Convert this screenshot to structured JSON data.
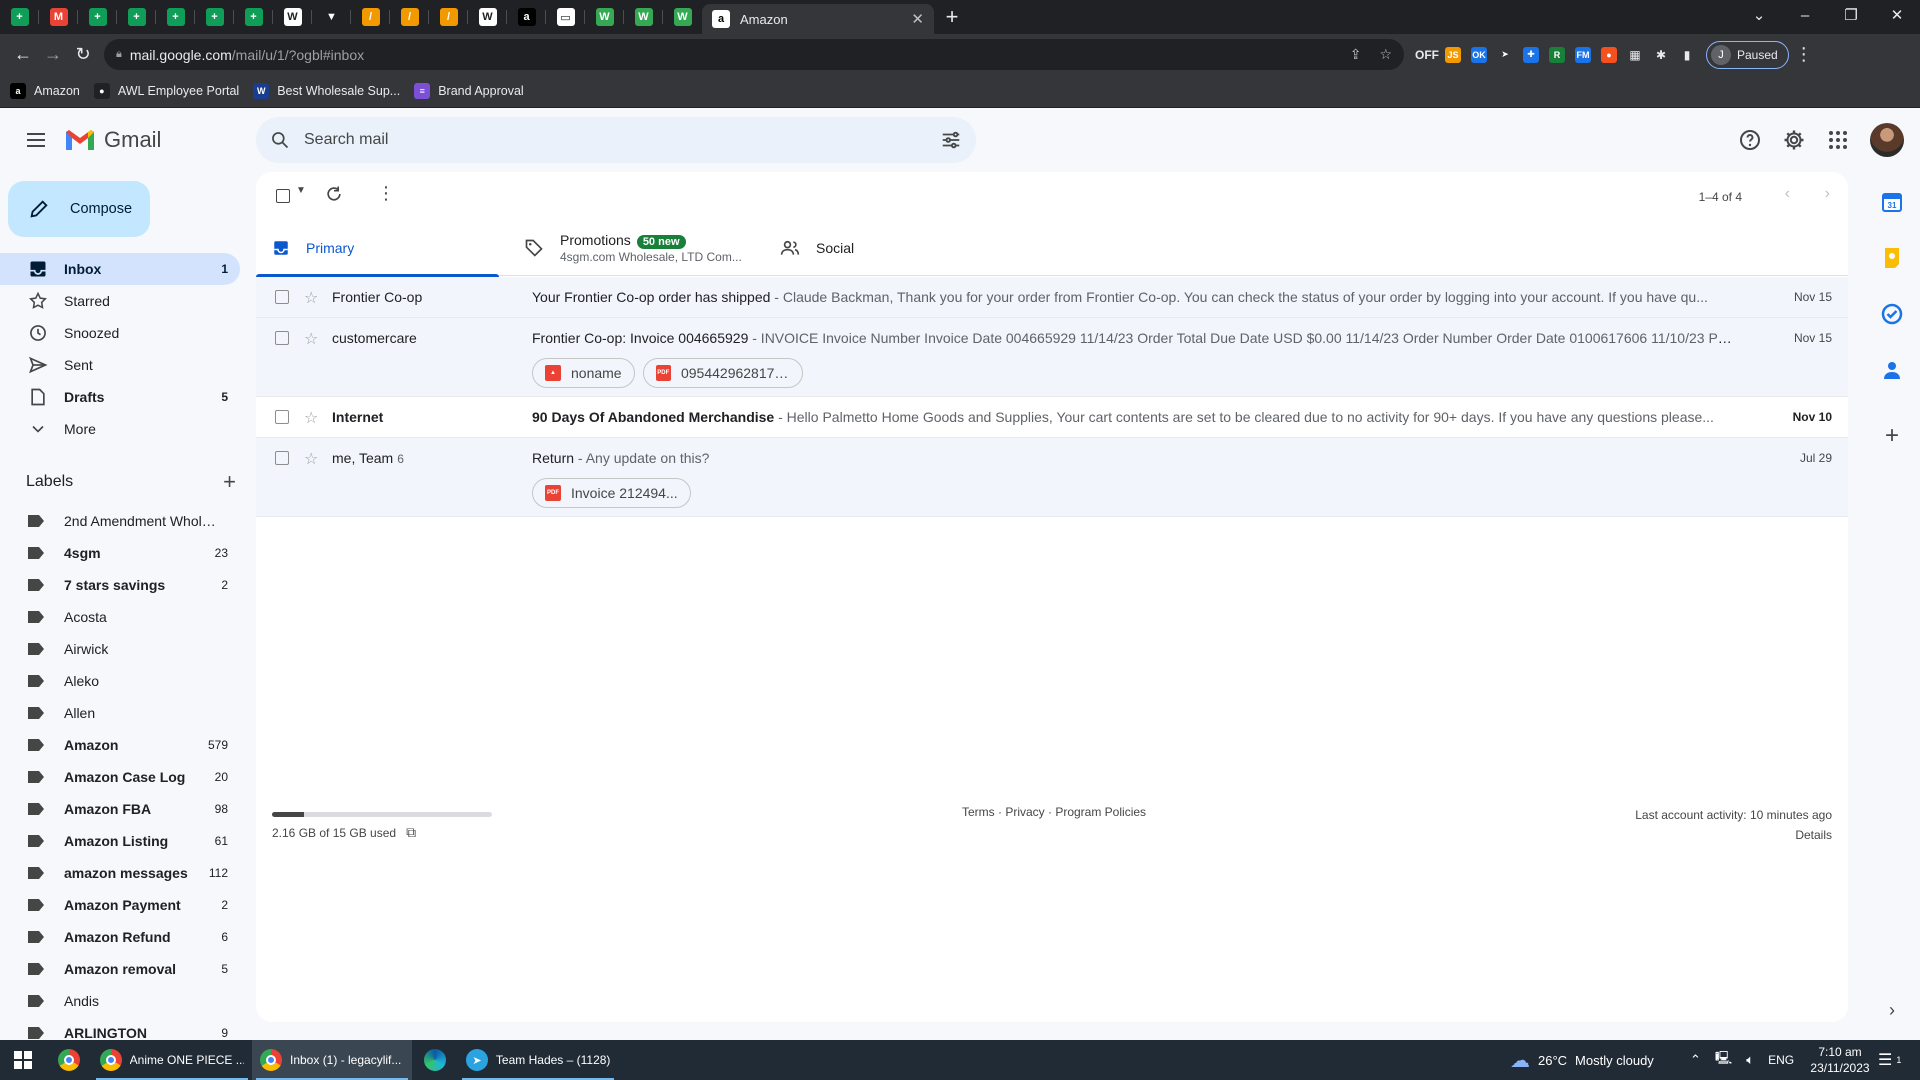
{
  "browser": {
    "active_tab_title": "Amazon",
    "pinned_tabs": [
      {
        "icon": "green-sheets-icon",
        "color": "#0f9d58",
        "glyph": "+"
      },
      {
        "icon": "gmail-icon",
        "color": "#ea4335",
        "glyph": "M"
      },
      {
        "icon": "green-sheets-icon",
        "color": "#0f9d58",
        "glyph": "+"
      },
      {
        "icon": "green-sheets-icon",
        "color": "#0f9d58",
        "glyph": "+"
      },
      {
        "icon": "green-sheets-icon",
        "color": "#0f9d58",
        "glyph": "+"
      },
      {
        "icon": "green-sheets-icon",
        "color": "#0f9d58",
        "glyph": "+"
      },
      {
        "icon": "green-sheets-icon",
        "color": "#0f9d58",
        "glyph": "+"
      },
      {
        "icon": "document-icon",
        "color": "#ffffff",
        "glyph": "W"
      },
      {
        "icon": "red-arrow-icon",
        "color": "#202124",
        "glyph": "▼"
      },
      {
        "icon": "slash-icon",
        "color": "#f29900",
        "glyph": "/"
      },
      {
        "icon": "slash-icon",
        "color": "#f29900",
        "glyph": "/"
      },
      {
        "icon": "slash-icon",
        "color": "#f29900",
        "glyph": "/"
      },
      {
        "icon": "document-icon",
        "color": "#ffffff",
        "glyph": "W"
      },
      {
        "icon": "amazon-icon",
        "color": "#000000",
        "glyph": "a"
      },
      {
        "icon": "image-icon",
        "color": "#ffffff",
        "glyph": "▭"
      },
      {
        "icon": "w-icon",
        "color": "#34a853",
        "glyph": "W"
      },
      {
        "icon": "w-icon",
        "color": "#34a853",
        "glyph": "W"
      },
      {
        "icon": "w-icon",
        "color": "#34a853",
        "glyph": "W"
      }
    ],
    "url_host": "mail.google.com",
    "url_path": "/mail/u/1/?ogbl#inbox",
    "profile_initial": "J",
    "profile_status": "Paused",
    "bookmarks": [
      {
        "label": "Amazon",
        "icon": "amazon-icon",
        "color": "#000000",
        "glyph": "a"
      },
      {
        "label": "AWL Employee Portal",
        "icon": "portal-icon",
        "color": "#202124",
        "glyph": "●"
      },
      {
        "label": "Best Wholesale Sup...",
        "icon": "wholesale-icon",
        "color": "#1a3e8f",
        "glyph": "W"
      },
      {
        "label": "Brand Approval",
        "icon": "brand-icon",
        "color": "#7b4fd6",
        "glyph": "≡"
      }
    ],
    "extensions": [
      {
        "icon": "off-extension-icon",
        "color": "#e8eaed",
        "glyph": "OFF"
      },
      {
        "icon": "js-extension-icon",
        "color": "#f29900",
        "glyph": "JS"
      },
      {
        "icon": "ok-extension-icon",
        "color": "#1a73e8",
        "glyph": "OK"
      },
      {
        "icon": "arrow-extension-icon",
        "color": "#35363a",
        "glyph": "➤"
      },
      {
        "icon": "puzzle-blue-icon",
        "color": "#1a73e8",
        "glyph": "✚"
      },
      {
        "icon": "r-extension-icon",
        "color": "#188038",
        "glyph": "R"
      },
      {
        "icon": "fm-extension-icon",
        "color": "#1a73e8",
        "glyph": "FM"
      },
      {
        "icon": "circle-extension-icon",
        "color": "#f4511e",
        "glyph": "●"
      },
      {
        "icon": "grid-extension-icon",
        "color": "#e8eaed",
        "glyph": "▦"
      },
      {
        "icon": "extensions-puzzle-icon",
        "color": "#e8eaed",
        "glyph": "✱"
      },
      {
        "icon": "side-panel-icon",
        "color": "#e8eaed",
        "glyph": "▮"
      }
    ]
  },
  "gmail": {
    "logo_text": "Gmail",
    "search_placeholder": "Search mail",
    "compose_label": "Compose",
    "nav": [
      {
        "name": "inbox",
        "label": "Inbox",
        "count": "1",
        "icon": "inbox-icon",
        "active": true
      },
      {
        "name": "starred",
        "label": "Starred",
        "count": "",
        "icon": "star-icon"
      },
      {
        "name": "snoozed",
        "label": "Snoozed",
        "count": "",
        "icon": "clock-icon"
      },
      {
        "name": "sent",
        "label": "Sent",
        "count": "",
        "icon": "send-icon"
      },
      {
        "name": "drafts",
        "label": "Drafts",
        "count": "5",
        "icon": "draft-icon",
        "bold": true
      },
      {
        "name": "more",
        "label": "More",
        "count": "",
        "icon": "chevron-down-icon"
      }
    ],
    "labels_title": "Labels",
    "labels": [
      {
        "label": "2nd Amendment Whole...",
        "count": "",
        "bold": false
      },
      {
        "label": "4sgm",
        "count": "23",
        "bold": true
      },
      {
        "label": "7 stars savings",
        "count": "2",
        "bold": true
      },
      {
        "label": "Acosta",
        "count": "",
        "bold": false
      },
      {
        "label": "Airwick",
        "count": "",
        "bold": false
      },
      {
        "label": "Aleko",
        "count": "",
        "bold": false
      },
      {
        "label": "Allen",
        "count": "",
        "bold": false
      },
      {
        "label": "Amazon",
        "count": "579",
        "bold": true
      },
      {
        "label": "Amazon Case Log",
        "count": "20",
        "bold": true
      },
      {
        "label": "Amazon FBA",
        "count": "98",
        "bold": true
      },
      {
        "label": "Amazon Listing",
        "count": "61",
        "bold": true
      },
      {
        "label": "amazon messages",
        "count": "112",
        "bold": true
      },
      {
        "label": "Amazon Payment",
        "count": "2",
        "bold": true
      },
      {
        "label": "Amazon Refund",
        "count": "6",
        "bold": true
      },
      {
        "label": "Amazon removal",
        "count": "5",
        "bold": true
      },
      {
        "label": "Andis",
        "count": "",
        "bold": false
      },
      {
        "label": "ARLINGTON",
        "count": "9",
        "bold": true
      }
    ],
    "pager": "1–4 of 4",
    "tabs": {
      "primary": "Primary",
      "promotions": "Promotions",
      "promotions_badge": "50 new",
      "promotions_sub": "4sgm.com Wholesale, LTD Com...",
      "social": "Social"
    },
    "emails": [
      {
        "sender": "Frontier Co-op",
        "count": "",
        "subject": "Your Frontier Co-op order has shipped",
        "snippet": " - Claude Backman, Thank you for your order from Frontier Co-op. You can check the status of your order by logging into your account. If you have qu...",
        "date": "Nov 15",
        "unread": false,
        "attachments": []
      },
      {
        "sender": "customercare",
        "count": "",
        "subject": "Frontier Co-op: Invoice 004665929",
        "snippet": " - INVOICE Invoice Number Invoice Date 004665929 11/14/23 Order Total Due Date USD $0.00 11/14/23 Order Number Order Date 0100617606 11/10/23 Ple...",
        "date": "Nov 15",
        "unread": false,
        "attachments": [
          {
            "name": "noname",
            "type": "image"
          },
          {
            "name": "0954429628179...",
            "type": "pdf"
          }
        ]
      },
      {
        "sender": "Internet",
        "count": "",
        "subject": "90 Days Of Abandoned Merchandise",
        "snippet": " - Hello Palmetto Home Goods and Supplies, Your cart contents are set to be cleared due to no activity for 90+ days. If you have any questions please...",
        "date": "Nov 10",
        "unread": true,
        "attachments": []
      },
      {
        "sender": "me, Team",
        "count": "6",
        "subject": "Return",
        "snippet": " - Any update on this?",
        "date": "Jul 29",
        "unread": false,
        "attachments": [
          {
            "name": "Invoice 212494...",
            "type": "pdf"
          }
        ]
      }
    ],
    "storage_text": "2.16 GB of 15 GB used",
    "storage_fraction": 0.144,
    "footer_links": "Terms · Privacy · Program Policies",
    "activity_line": "Last account activity: 10 minutes ago",
    "details_label": "Details",
    "side_apps": [
      {
        "icon": "calendar-icon",
        "color": "#1a73e8"
      },
      {
        "icon": "keep-icon",
        "color": "#fbbc04"
      },
      {
        "icon": "tasks-icon",
        "color": "#1a73e8"
      },
      {
        "icon": "contacts-icon",
        "color": "#1a73e8"
      }
    ]
  },
  "taskbar": {
    "apps": [
      {
        "name": "chrome-pinned",
        "label": "",
        "open": false
      },
      {
        "name": "chrome-anime",
        "label": "Anime ONE PIECE ...",
        "open": true
      },
      {
        "name": "chrome-inbox",
        "label": "Inbox (1) - legacylif...",
        "open": true,
        "focus": true
      },
      {
        "name": "edge",
        "label": "",
        "open": false
      },
      {
        "name": "telegram",
        "label": "Team Hades – (1128)",
        "open": true
      }
    ],
    "weather_temp": "26°C",
    "weather_desc": "Mostly cloudy",
    "lang": "ENG",
    "time": "7:10 am",
    "date": "23/11/2023",
    "notif_count": "1"
  }
}
